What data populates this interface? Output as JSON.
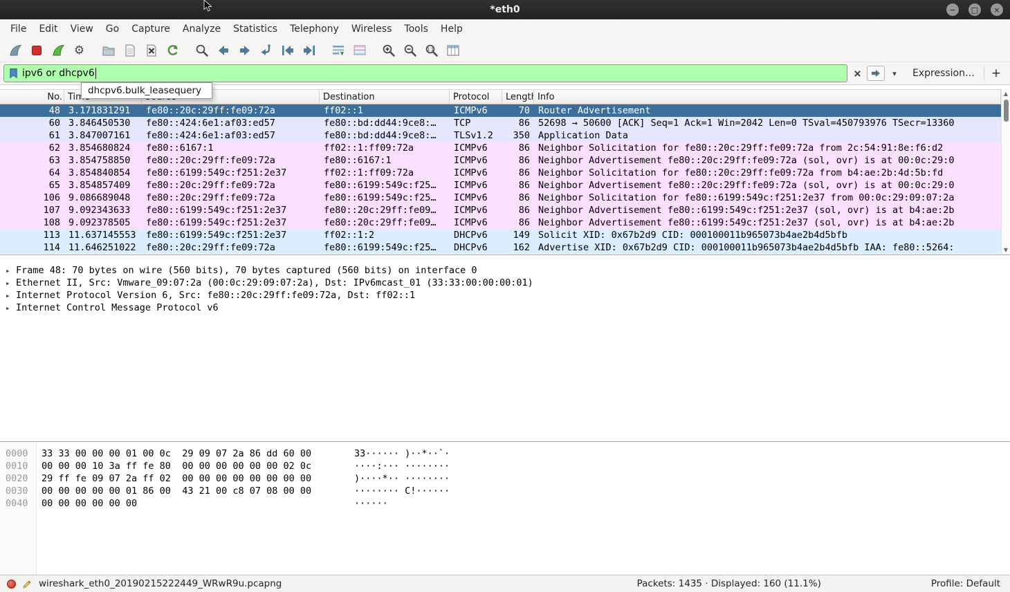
{
  "window": {
    "title": "*eth0",
    "controls": [
      {
        "name": "minimize-button",
        "icon": "minimize"
      },
      {
        "name": "maximize-button",
        "icon": "maximize"
      },
      {
        "name": "close-button",
        "icon": "close"
      }
    ]
  },
  "menu": {
    "items": [
      "File",
      "Edit",
      "View",
      "Go",
      "Capture",
      "Analyze",
      "Statistics",
      "Telephony",
      "Wireless",
      "Tools",
      "Help"
    ]
  },
  "toolbar": {
    "buttons": [
      {
        "icon": "start-capture",
        "name": "start-capture-button",
        "cls": ""
      },
      {
        "icon": "stop-capture",
        "name": "stop-capture-button",
        "cls": ""
      },
      {
        "icon": "restart-capture",
        "name": "restart-capture-button",
        "cls": ""
      },
      {
        "icon": "capture-options",
        "name": "capture-options-button",
        "cls": ""
      },
      {
        "icon": "open-file",
        "name": "open-capture-button",
        "cls": "gap"
      },
      {
        "icon": "save-file",
        "name": "save-capture-button",
        "cls": ""
      },
      {
        "icon": "close-file",
        "name": "close-capture-button",
        "cls": ""
      },
      {
        "icon": "reload-file",
        "name": "reload-capture-button",
        "cls": ""
      },
      {
        "icon": "find-packet",
        "name": "find-packet-button",
        "cls": "gap"
      },
      {
        "icon": "go-back",
        "name": "go-back-button",
        "cls": ""
      },
      {
        "icon": "go-forward",
        "name": "go-forward-button",
        "cls": ""
      },
      {
        "icon": "go-to-packet",
        "name": "go-to-packet-button",
        "cls": ""
      },
      {
        "icon": "go-first",
        "name": "go-first-packet-button",
        "cls": ""
      },
      {
        "icon": "go-last",
        "name": "go-last-packet-button",
        "cls": ""
      },
      {
        "icon": "auto-scroll",
        "name": "auto-scroll-button",
        "cls": "gap"
      },
      {
        "icon": "colorize",
        "name": "colorize-button",
        "cls": ""
      },
      {
        "icon": "zoom-in",
        "name": "zoom-in-button",
        "cls": "gap"
      },
      {
        "icon": "zoom-out",
        "name": "zoom-out-button",
        "cls": ""
      },
      {
        "icon": "zoom-original",
        "name": "zoom-original-button",
        "cls": ""
      },
      {
        "icon": "resize-columns",
        "name": "resize-columns-button",
        "cls": ""
      }
    ]
  },
  "filter": {
    "value": "ipv6 or dhcpv6",
    "autocomplete_items": [
      "dhcpv6.bulk_leasequery"
    ],
    "expression_label": "Expression…",
    "add_label": "+"
  },
  "packet_list": {
    "columns": [
      {
        "label": "No.",
        "cls": "c-no"
      },
      {
        "label": "Time",
        "cls": "c-time"
      },
      {
        "label": "Source",
        "cls": "c-src"
      },
      {
        "label": "Destination",
        "cls": "c-dst"
      },
      {
        "label": "Protocol",
        "cls": "c-proto"
      },
      {
        "label": "Length",
        "cls": "c-len"
      },
      {
        "label": "Info",
        "cls": "c-info"
      }
    ],
    "rows": [
      {
        "cls": "sel",
        "no": "48",
        "time": "3.171831291",
        "source": "fe80::20c:29ff:fe09:72a",
        "destination": "ff02::1",
        "protocol": "ICMPv6",
        "length": "70",
        "info": "Router Advertisement"
      },
      {
        "cls": "tcp",
        "no": "60",
        "time": "3.846450530",
        "source": "fe80::424:6e1:af03:ed57",
        "destination": "fe80::bd:dd44:9ce8:…",
        "protocol": "TCP",
        "length": "86",
        "info": "52698 → 50600 [ACK] Seq=1 Ack=1 Win=2042 Len=0 TSval=450793976 TSecr=13360"
      },
      {
        "cls": "tcp",
        "no": "61",
        "time": "3.847007161",
        "source": "fe80::424:6e1:af03:ed57",
        "destination": "fe80::bd:dd44:9ce8:…",
        "protocol": "TLSv1.2",
        "length": "350",
        "info": "Application Data"
      },
      {
        "cls": "icmp",
        "no": "62",
        "time": "3.854680824",
        "source": "fe80::6167:1",
        "destination": "ff02::1:ff09:72a",
        "protocol": "ICMPv6",
        "length": "86",
        "info": "Neighbor Solicitation for fe80::20c:29ff:fe09:72a from 2c:54:91:8e:f6:d2"
      },
      {
        "cls": "icmp",
        "no": "63",
        "time": "3.854758850",
        "source": "fe80::20c:29ff:fe09:72a",
        "destination": "fe80::6167:1",
        "protocol": "ICMPv6",
        "length": "86",
        "info": "Neighbor Advertisement fe80::20c:29ff:fe09:72a (sol, ovr) is at 00:0c:29:0"
      },
      {
        "cls": "icmp",
        "no": "64",
        "time": "3.854840854",
        "source": "fe80::6199:549c:f251:2e37",
        "destination": "ff02::1:ff09:72a",
        "protocol": "ICMPv6",
        "length": "86",
        "info": "Neighbor Solicitation for fe80::20c:29ff:fe09:72a from b4:ae:2b:4d:5b:fd"
      },
      {
        "cls": "icmp",
        "no": "65",
        "time": "3.854857409",
        "source": "fe80::20c:29ff:fe09:72a",
        "destination": "fe80::6199:549c:f25…",
        "protocol": "ICMPv6",
        "length": "86",
        "info": "Neighbor Advertisement fe80::20c:29ff:fe09:72a (sol, ovr) is at 00:0c:29:0"
      },
      {
        "cls": "icmp",
        "no": "106",
        "time": "9.086689048",
        "source": "fe80::20c:29ff:fe09:72a",
        "destination": "fe80::6199:549c:f25…",
        "protocol": "ICMPv6",
        "length": "86",
        "info": "Neighbor Solicitation for fe80::6199:549c:f251:2e37 from 00:0c:29:09:07:2a"
      },
      {
        "cls": "icmp",
        "no": "107",
        "time": "9.092343633",
        "source": "fe80::6199:549c:f251:2e37",
        "destination": "fe80::20c:29ff:fe09…",
        "protocol": "ICMPv6",
        "length": "86",
        "info": "Neighbor Advertisement fe80::6199:549c:f251:2e37 (sol, ovr) is at b4:ae:2b"
      },
      {
        "cls": "icmp",
        "no": "108",
        "time": "9.092378505",
        "source": "fe80::6199:549c:f251:2e37",
        "destination": "fe80::20c:29ff:fe09…",
        "protocol": "ICMPv6",
        "length": "86",
        "info": "Neighbor Advertisement fe80::6199:549c:f251:2e37 (sol, ovr) is at b4:ae:2b"
      },
      {
        "cls": "dhcp",
        "no": "113",
        "time": "11.637145553",
        "source": "fe80::6199:549c:f251:2e37",
        "destination": "ff02::1:2",
        "protocol": "DHCPv6",
        "length": "149",
        "info": "Solicit XID: 0x67b2d9 CID: 000100011b965073b4ae2b4d5bfb"
      },
      {
        "cls": "dhcp",
        "no": "114",
        "time": "11.646251022",
        "source": "fe80::20c:29ff:fe09:72a",
        "destination": "fe80::6199:549c:f25…",
        "protocol": "DHCPv6",
        "length": "162",
        "info": "Advertise XID: 0x67b2d9 CID: 000100011b965073b4ae2b4d5bfb IAA: fe80::5264:"
      }
    ]
  },
  "packet_details": {
    "expander": "▸",
    "lines": [
      "Frame 48: 70 bytes on wire (560 bits), 70 bytes captured (560 bits) on interface 0",
      "Ethernet II, Src: Vmware_09:07:2a (00:0c:29:09:07:2a), Dst: IPv6mcast_01 (33:33:00:00:00:01)",
      "Internet Protocol Version 6, Src: fe80::20c:29ff:fe09:72a, Dst: ff02::1",
      "Internet Control Message Protocol v6"
    ]
  },
  "hex_dump": {
    "lines": [
      {
        "offset": "0000",
        "hex": "33 33 00 00 00 01 00 0c  29 09 07 2a 86 dd 60 00",
        "ascii": "33······ )··*··`·"
      },
      {
        "offset": "0010",
        "hex": "00 00 00 10 3a ff fe 80  00 00 00 00 00 00 02 0c",
        "ascii": "····:··· ········"
      },
      {
        "offset": "0020",
        "hex": "29 ff fe 09 07 2a ff 02  00 00 00 00 00 00 00 00",
        "ascii": ")····*·· ········"
      },
      {
        "offset": "0030",
        "hex": "00 00 00 00 00 01 86 00  43 21 00 c8 07 08 00 00",
        "ascii": "········ C!······"
      },
      {
        "offset": "0040",
        "hex": "00 00 00 00 00 00",
        "ascii": "······"
      }
    ]
  },
  "status_bar": {
    "filename": "wireshark_eth0_20190215222449_WRwR9u.pcapng",
    "packets": "Packets: 1435 · Displayed: 160 (11.1%)",
    "profile": "Profile: Default"
  },
  "colors": {
    "filter_valid_bg": "#afffaf",
    "row_selected": "#3c6e9c",
    "row_icmpv6": "#fce0ff",
    "row_tcp": "#e7e6ff",
    "row_dhcpv6": "#daeeff"
  }
}
